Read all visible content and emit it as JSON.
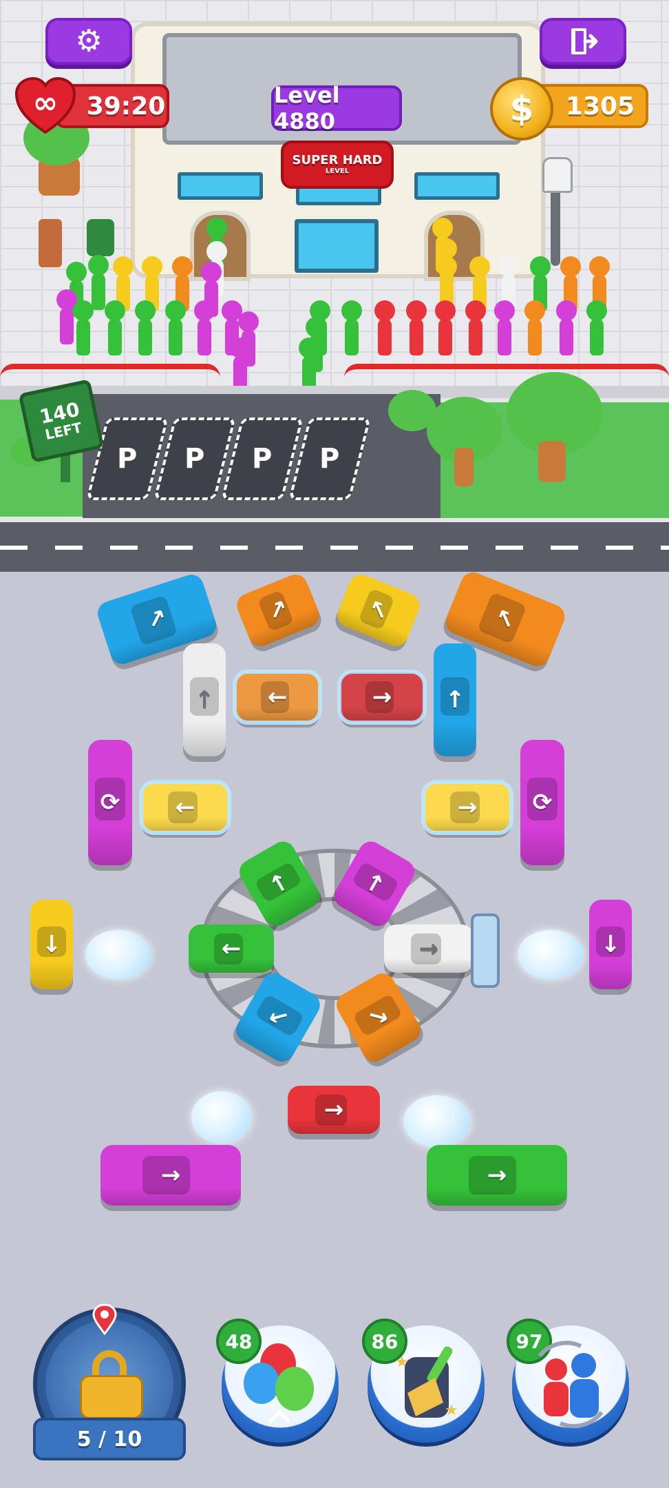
{
  "hud": {
    "lives_value": "39:20",
    "lives_symbol": "∞",
    "level_label": "Level 4880",
    "difficulty_line1": "SUPER HARD",
    "difficulty_line2": "LEVEL",
    "coins_value": "1305",
    "coin_symbol": "$"
  },
  "scene": {
    "sign_count": "140",
    "sign_label": "LEFT",
    "parking_spots": [
      "P",
      "P",
      "P",
      "P"
    ]
  },
  "boosters": [
    {
      "name": "balloons",
      "count": "48"
    },
    {
      "name": "sweep",
      "count": "86"
    },
    {
      "name": "shuffle-people",
      "count": "97"
    }
  ],
  "progress": {
    "label": "5 / 10",
    "current": 5,
    "total": 10
  },
  "colors": {
    "purple_button": "#9a3ae0",
    "red_lives": "#e0323a",
    "gold_coin": "#f2a51c",
    "grass": "#5cc25a",
    "road": "#5b5d66",
    "board": "#c5c8d4"
  },
  "vehicles": [
    {
      "id": "blue-bus-top-left",
      "color": "#22a6e8",
      "arrow": "↗"
    },
    {
      "id": "orange-car-top",
      "color": "#f28a1e",
      "arrow": "↗"
    },
    {
      "id": "yellow-car-top",
      "color": "#f6cb1d",
      "arrow": "↖"
    },
    {
      "id": "orange-bus-top-right",
      "color": "#f28a1e",
      "arrow": "↖"
    },
    {
      "id": "white-van",
      "color": "#eeeeee",
      "arrow": "↑"
    },
    {
      "id": "frozen-orange-car",
      "color": "#f28a1e",
      "arrow": "←"
    },
    {
      "id": "frozen-red-car",
      "color": "#e8343a",
      "arrow": "→"
    },
    {
      "id": "blue-van",
      "color": "#22a6e8",
      "arrow": "↑"
    },
    {
      "id": "magenta-bus-left",
      "color": "#d43fd8",
      "arrow": "⟳"
    },
    {
      "id": "frozen-yellow-car-left",
      "color": "#f6cb1d",
      "arrow": "←"
    },
    {
      "id": "frozen-yellow-car-right",
      "color": "#f6cb1d",
      "arrow": "→"
    },
    {
      "id": "magenta-bus-right",
      "color": "#d43fd8",
      "arrow": "⟳"
    },
    {
      "id": "green-car-roundabout-top",
      "color": "#35c23a",
      "arrow": "↑"
    },
    {
      "id": "magenta-car-roundabout-top",
      "color": "#d43fd8",
      "arrow": "↑"
    },
    {
      "id": "green-car-roundabout-left",
      "color": "#35c23a",
      "arrow": "←"
    },
    {
      "id": "white-car-plow",
      "color": "#f2f2f2",
      "arrow": "→"
    },
    {
      "id": "blue-car-roundabout",
      "color": "#22a6e8",
      "arrow": "↙"
    },
    {
      "id": "orange-car-roundabout",
      "color": "#f28a1e",
      "arrow": "↘"
    },
    {
      "id": "yellow-car-far-left",
      "color": "#f6cb1d",
      "arrow": "↓"
    },
    {
      "id": "magenta-car-far-right",
      "color": "#d43fd8",
      "arrow": "↓"
    },
    {
      "id": "red-car-bottom",
      "color": "#e8343a",
      "arrow": "→"
    },
    {
      "id": "magenta-bus-bottom",
      "color": "#d43fd8",
      "arrow": "→"
    },
    {
      "id": "green-bus-bottom",
      "color": "#35c23a",
      "arrow": "→"
    }
  ]
}
